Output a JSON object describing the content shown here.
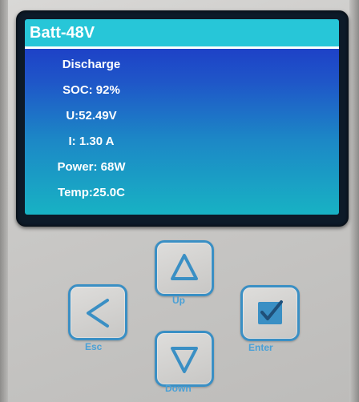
{
  "screen": {
    "title": "Batt-48V",
    "readings": [
      "Discharge",
      "SOC: 92%",
      "U:52.49V",
      "I: 1.30 A",
      "Power:  68W",
      "Temp:25.0C"
    ]
  },
  "buttons": {
    "up": {
      "label": "Up",
      "icon": "triangle-up-icon"
    },
    "esc": {
      "label": "Esc",
      "icon": "chevron-left-icon"
    },
    "enter": {
      "label": "Enter",
      "icon": "checkbox-check-icon"
    },
    "down": {
      "label": "Down",
      "icon": "triangle-down-icon"
    }
  },
  "colors": {
    "accent": "#3a8fc4",
    "title_bar": "#27c6d8",
    "screen_top": "#1d2fc6",
    "screen_bottom": "#18b2c4"
  }
}
